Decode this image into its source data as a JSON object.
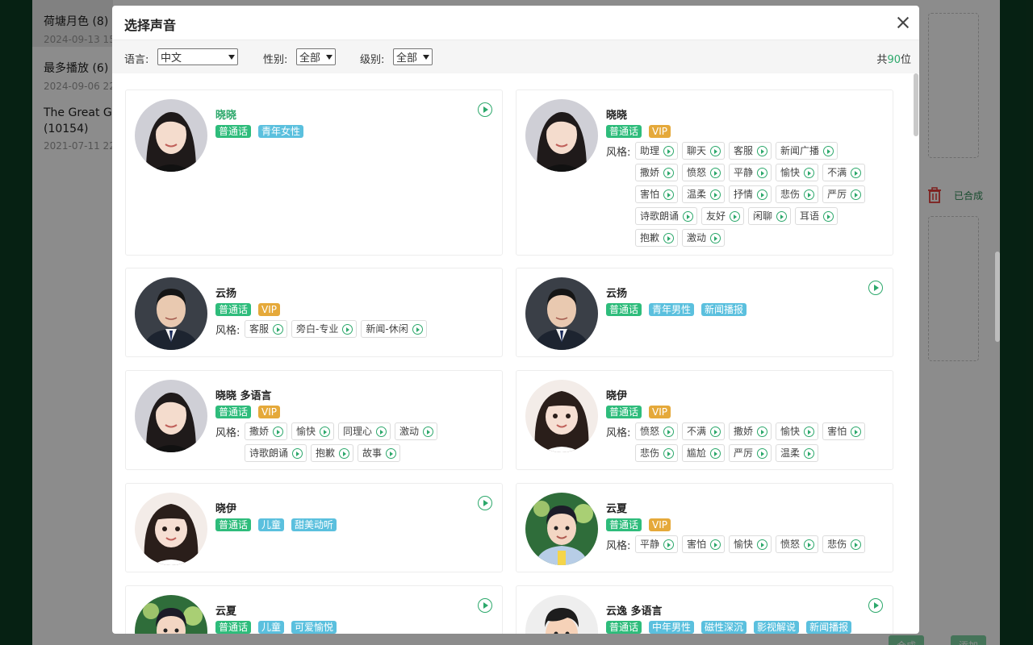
{
  "background": {
    "sidebar_items": [
      {
        "title": "荷塘月色 (8)",
        "date": "2024-09-13 15"
      },
      {
        "title": "最多播放 (6)",
        "date": "2024-09-06 22"
      },
      {
        "title": "The Great Ga",
        "title2": "(10154)",
        "date": "2021-07-11 22"
      }
    ],
    "status_text": "已合成",
    "btn_left": "合成",
    "btn_right": "添加"
  },
  "modal": {
    "title": "选择声音",
    "filters": {
      "language_label": "语言:",
      "language_value": "中文",
      "gender_label": "性别:",
      "gender_value": "全部",
      "level_label": "级别:",
      "level_value": "全部",
      "total_prefix": "共",
      "total_count": "90",
      "total_suffix": "位"
    },
    "style_label": "风格:",
    "voices": [
      {
        "name": "晓晓",
        "tags": [
          {
            "text": "普通话",
            "kind": "green"
          },
          {
            "text": "青年女性",
            "kind": "blue"
          }
        ],
        "styles": [],
        "has_play": true,
        "avatar": "female"
      },
      {
        "name": "晓晓",
        "tags": [
          {
            "text": "普通话",
            "kind": "green"
          },
          {
            "text": "VIP",
            "kind": "vip"
          }
        ],
        "styles": [
          "助理",
          "聊天",
          "客服",
          "新闻广播",
          "撒娇",
          "愤怒",
          "平静",
          "愉快",
          "不满",
          "害怕",
          "温柔",
          "抒情",
          "悲伤",
          "严厉",
          "诗歌朗诵",
          "友好",
          "闲聊",
          "耳语",
          "抱歉",
          "激动"
        ],
        "has_play": false,
        "avatar": "female"
      },
      {
        "name": "云扬",
        "tags": [
          {
            "text": "普通话",
            "kind": "green"
          },
          {
            "text": "VIP",
            "kind": "vip"
          }
        ],
        "styles": [
          "客服",
          "旁白-专业",
          "新闻-休闲"
        ],
        "has_play": false,
        "avatar": "male"
      },
      {
        "name": "云扬",
        "tags": [
          {
            "text": "普通话",
            "kind": "green"
          },
          {
            "text": "青年男性",
            "kind": "blue"
          },
          {
            "text": "新闻播报",
            "kind": "blue"
          }
        ],
        "styles": [],
        "has_play": true,
        "avatar": "male"
      },
      {
        "name": "晓晓 多语言",
        "tags": [
          {
            "text": "普通话",
            "kind": "green"
          },
          {
            "text": "VIP",
            "kind": "vip"
          }
        ],
        "styles": [
          "撒娇",
          "愉快",
          "同理心",
          "激动",
          "诗歌朗诵",
          "抱歉",
          "故事"
        ],
        "has_play": false,
        "avatar": "female"
      },
      {
        "name": "晓伊",
        "tags": [
          {
            "text": "普通话",
            "kind": "green"
          },
          {
            "text": "VIP",
            "kind": "vip"
          }
        ],
        "styles": [
          "愤怒",
          "不满",
          "撒娇",
          "愉快",
          "害怕",
          "悲伤",
          "尴尬",
          "严厉",
          "温柔"
        ],
        "has_play": false,
        "avatar": "girl"
      },
      {
        "name": "晓伊",
        "tags": [
          {
            "text": "普通话",
            "kind": "green"
          },
          {
            "text": "儿童",
            "kind": "blue"
          },
          {
            "text": "甜美动听",
            "kind": "blue"
          }
        ],
        "styles": [],
        "has_play": true,
        "avatar": "girl"
      },
      {
        "name": "云夏",
        "tags": [
          {
            "text": "普通话",
            "kind": "green"
          },
          {
            "text": "VIP",
            "kind": "vip"
          }
        ],
        "styles": [
          "平静",
          "害怕",
          "愉快",
          "愤怒",
          "悲伤"
        ],
        "has_play": false,
        "avatar": "boy"
      },
      {
        "name": "云夏",
        "tags": [
          {
            "text": "普通话",
            "kind": "green"
          },
          {
            "text": "儿童",
            "kind": "blue"
          },
          {
            "text": "可爱愉悦",
            "kind": "blue"
          }
        ],
        "styles": [],
        "has_play": true,
        "avatar": "boy"
      },
      {
        "name": "云逸 多语言",
        "tags": [
          {
            "text": "普通话",
            "kind": "green"
          },
          {
            "text": "中年男性",
            "kind": "blue"
          },
          {
            "text": "磁性深沉",
            "kind": "blue"
          },
          {
            "text": "影视解说",
            "kind": "blue"
          },
          {
            "text": "新闻播报",
            "kind": "blue"
          }
        ],
        "styles": [],
        "has_play": true,
        "avatar": "cartoon"
      }
    ]
  },
  "colors": {
    "accent": "#2ca86b",
    "tag_green": "#2ebc7b",
    "tag_blue": "#5bc0de",
    "tag_vip": "#e5a93a"
  }
}
